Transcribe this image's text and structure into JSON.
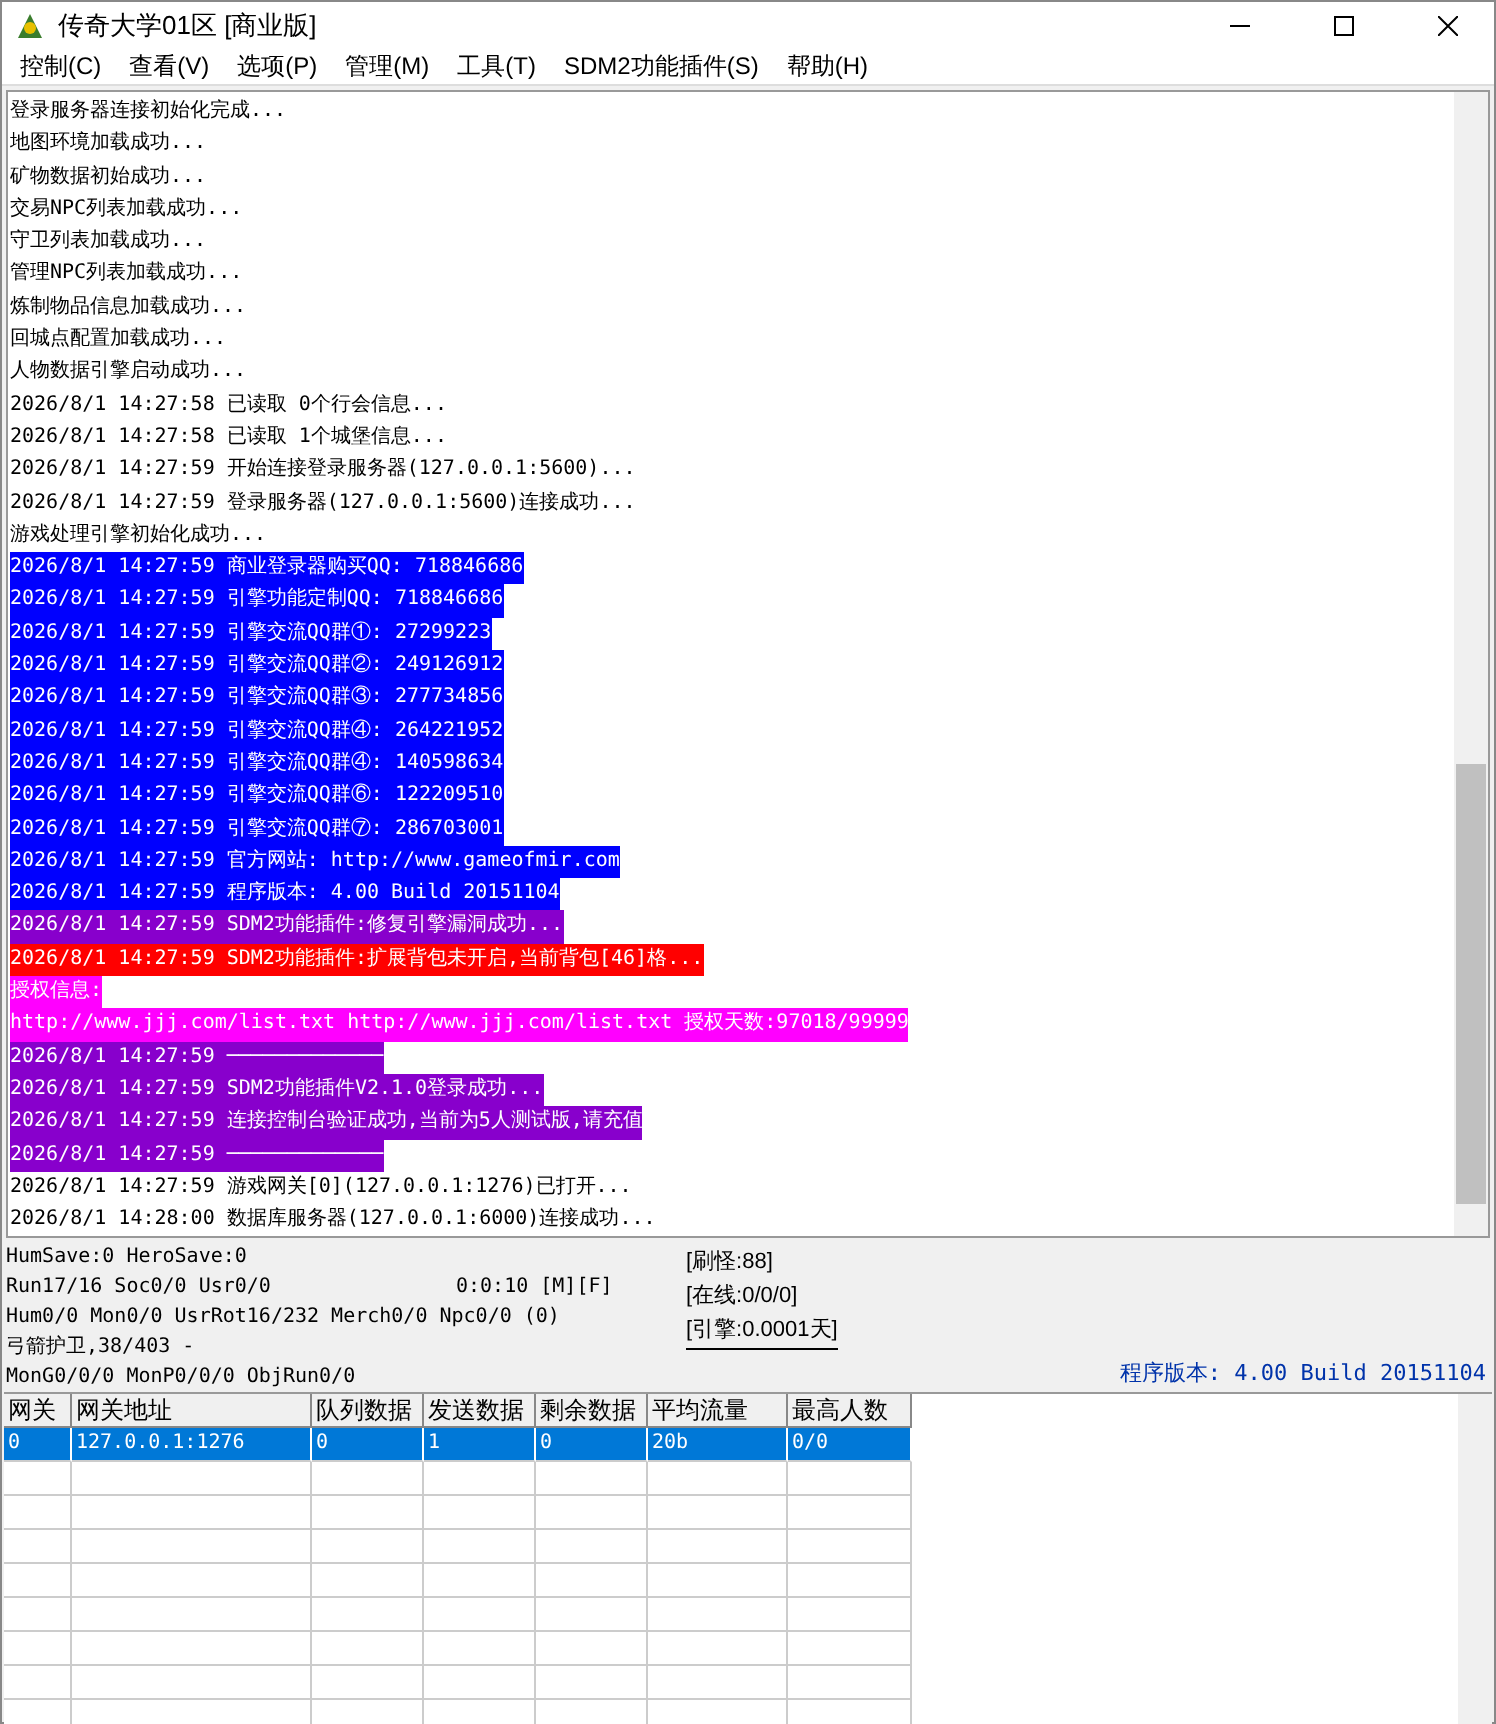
{
  "window": {
    "title": "传奇大学01区 [商业版]"
  },
  "menu": [
    "控制(C)",
    "查看(V)",
    "选项(P)",
    "管理(M)",
    "工具(T)",
    "SDM2功能插件(S)",
    "帮助(H)"
  ],
  "log": [
    {
      "text": "登录服务器连接初始化完成..."
    },
    {
      "text": "地图环境加载成功..."
    },
    {
      "text": "矿物数据初始成功..."
    },
    {
      "text": "交易NPC列表加载成功..."
    },
    {
      "text": "守卫列表加载成功..."
    },
    {
      "text": "管理NPC列表加载成功..."
    },
    {
      "text": "炼制物品信息加载成功..."
    },
    {
      "text": "回城点配置加载成功..."
    },
    {
      "text": "人物数据引擎启动成功..."
    },
    {
      "text": "2026/8/1 14:27:58 已读取 0个行会信息..."
    },
    {
      "text": "2026/8/1 14:27:58 已读取 1个城堡信息..."
    },
    {
      "text": "2026/8/1 14:27:59 开始连接登录服务器(127.0.0.1:5600)..."
    },
    {
      "text": "2026/8/1 14:27:59 登录服务器(127.0.0.1:5600)连接成功..."
    },
    {
      "text": "游戏处理引擎初始化成功..."
    },
    {
      "text": "2026/8/1 14:27:59 商业登录器购买QQ: 718846686",
      "color": "#0000ff"
    },
    {
      "text": "2026/8/1 14:27:59 引擎功能定制QQ: 718846686",
      "color": "#0000ff"
    },
    {
      "text": "2026/8/1 14:27:59 引擎交流QQ群①: 27299223",
      "color": "#0000ff"
    },
    {
      "text": "2026/8/1 14:27:59 引擎交流QQ群②: 249126912",
      "color": "#0000ff"
    },
    {
      "text": "2026/8/1 14:27:59 引擎交流QQ群③: 277734856",
      "color": "#0000ff"
    },
    {
      "text": "2026/8/1 14:27:59 引擎交流QQ群④: 264221952",
      "color": "#0000ff"
    },
    {
      "text": "2026/8/1 14:27:59 引擎交流QQ群④: 140598634",
      "color": "#0000ff"
    },
    {
      "text": "2026/8/1 14:27:59 引擎交流QQ群⑥: 122209510",
      "color": "#0000ff"
    },
    {
      "text": "2026/8/1 14:27:59 引擎交流QQ群⑦: 286703001",
      "color": "#0000ff"
    },
    {
      "text": "2026/8/1 14:27:59 官方网站: http://www.gameofmir.com",
      "color": "#0000ff"
    },
    {
      "text": "2026/8/1 14:27:59 程序版本: 4.00 Build 20151104",
      "color": "#0000ff"
    },
    {
      "text": "2026/8/1 14:27:59 SDM2功能插件:修复引擎漏洞成功...",
      "color": "#8800cc"
    },
    {
      "text": "2026/8/1 14:27:59 SDM2功能插件:扩展背包未开启,当前背包[46]格...",
      "color": "#ff0000"
    },
    {
      "text": "授权信息:",
      "color": "#ff00ff"
    },
    {
      "text": "http://www.jjj.com/list.txt http://www.jjj.com/list.txt 授权天数:97018/99999",
      "color": "#ff00ff"
    },
    {
      "text": "2026/8/1 14:27:59 ─────────────",
      "color": "#8800cc"
    },
    {
      "text": "2026/8/1 14:27:59 SDM2功能插件V2.1.0登录成功...",
      "color": "#8800cc"
    },
    {
      "text": "2026/8/1 14:27:59 连接控制台验证成功,当前为5人测试版,请充值",
      "color": "#8800cc"
    },
    {
      "text": "2026/8/1 14:27:59 ─────────────",
      "color": "#8800cc"
    },
    {
      "text": "2026/8/1 14:27:59 游戏网关[0](127.0.0.1:1276)已打开..."
    },
    {
      "text": "2026/8/1 14:28:00 数据库服务器(127.0.0.1:6000)连接成功..."
    }
  ],
  "status": {
    "lines": [
      "HumSave:0 HeroSave:0",
      "Run17/16 Soc0/0 Usr0/0",
      "Hum0/0 Mon0/0 UsrRot16/232 Merch0/0 Npc0/0 (0)",
      "弓箭护卫,38/403 -",
      "MonG0/0/0 MonP0/0/0 ObjRun0/0"
    ],
    "timer": "0:0:10 [M][F]",
    "counters": [
      "[刷怪:88]",
      "[在线:0/0/0]",
      "[引擎:0.0001天]"
    ],
    "version": "程序版本: 4.00 Build 20151104"
  },
  "table": {
    "columns": [
      "网关",
      "网关地址",
      "队列数据",
      "发送数据",
      "剩余数据",
      "平均流量",
      "最高人数"
    ],
    "rows": [
      {
        "cells": [
          "0",
          "127.0.0.1:1276",
          "0",
          "1",
          "0",
          "20b",
          "0/0"
        ],
        "selected": true
      }
    ]
  }
}
